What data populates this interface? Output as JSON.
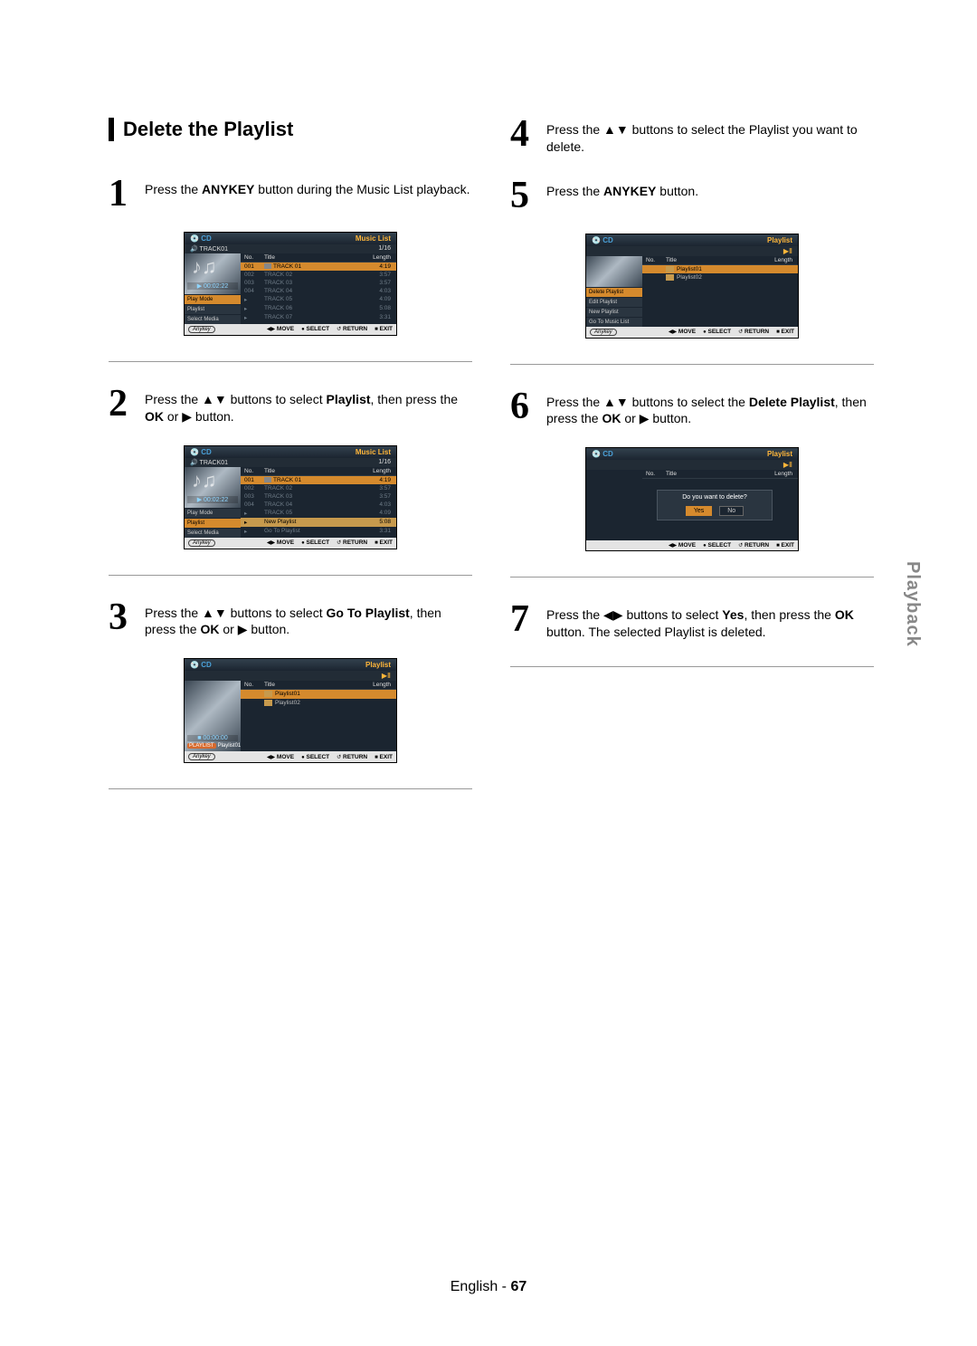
{
  "title": "Delete the Playlist",
  "side_tab": "Playback",
  "footer": {
    "lang": "English",
    "sep": " - ",
    "page": "67"
  },
  "step1": {
    "num": "1",
    "t1": "Press the ",
    "b1": "ANYKEY",
    "t2": " button during the Music List playback."
  },
  "step2": {
    "num": "2",
    "t1": "Press the ▲▼ buttons to select ",
    "b1": "Playlist",
    "t2": ", then press the ",
    "b2": "OK",
    "t3": " or ▶ button."
  },
  "step3": {
    "num": "3",
    "t1": "Press the ▲▼ buttons to select ",
    "b1": "Go To Playlist",
    "t2": ", then press the ",
    "b2": "OK",
    "t3": " or ▶ button."
  },
  "step4": {
    "num": "4",
    "t1": "Press the ▲▼ buttons to select the Playlist you want to delete."
  },
  "step5": {
    "num": "5",
    "t1": "Press the ",
    "b1": "ANYKEY",
    "t2": " button."
  },
  "step6": {
    "num": "6",
    "t1": "Press the ▲▼ buttons to select the ",
    "b1": "Delete Playlist",
    "t2": ", then press the  ",
    "b2": "OK",
    "t3": " or ▶ button."
  },
  "step7": {
    "num": "7",
    "t1": "Press the ◀▶ buttons to select ",
    "b1": "Yes",
    "t2": ", then press the ",
    "b2": "OK",
    "t3": " button. The selected Playlist is deleted."
  },
  "osd_common": {
    "nav": {
      "anykey": "Anykey",
      "move": "MOVE",
      "select": "SELECT",
      "return": "RETURN",
      "exit": "EXIT",
      "move_icon": "◀▶",
      "select_icon": "●",
      "return_icon": "↺",
      "exit_icon": "■"
    },
    "cols": {
      "no": "No.",
      "title": "Title",
      "length": "Length"
    }
  },
  "osd1": {
    "cd": "CD",
    "label": "Music List",
    "track": "TRACK01",
    "counter": "1/16",
    "time": "00:02:22",
    "menu": [
      "Play Mode",
      "Playlist",
      "Select Media"
    ],
    "tracks": [
      {
        "no": "001",
        "title": "TRACK 01",
        "len": "4:19"
      },
      {
        "no": "002",
        "title": "TRACK 02",
        "len": "3:57"
      },
      {
        "no": "003",
        "title": "TRACK 03",
        "len": "3:57"
      },
      {
        "no": "004",
        "title": "TRACK 04",
        "len": "4:03"
      },
      {
        "no": "",
        "title": "TRACK 05",
        "len": "4:09"
      },
      {
        "no": "",
        "title": "TRACK 06",
        "len": "5:08"
      },
      {
        "no": "",
        "title": "TRACK 07",
        "len": "3:31"
      }
    ]
  },
  "osd2": {
    "cd": "CD",
    "label": "Music List",
    "track": "TRACK01",
    "counter": "1/16",
    "time": "00:02:22",
    "menu": [
      "Play Mode",
      "Playlist",
      "Select Media"
    ],
    "submenu": [
      "New Playlist",
      "Go To Playlist"
    ],
    "tracks": [
      {
        "no": "001",
        "title": "TRACK 01",
        "len": "4:19"
      },
      {
        "no": "002",
        "title": "TRACK 02",
        "len": "3:57"
      },
      {
        "no": "003",
        "title": "TRACK 03",
        "len": "3:57"
      },
      {
        "no": "004",
        "title": "TRACK 04",
        "len": "4:03"
      },
      {
        "no": "",
        "title": "TRACK 05",
        "len": "4:09"
      },
      {
        "no": "",
        "title": "New Playlist",
        "len": "5:08"
      },
      {
        "no": "",
        "title": "Go To Playlist",
        "len": "3:31"
      }
    ]
  },
  "osd3": {
    "cd": "CD",
    "label": "Playlist",
    "time": "00:00:00",
    "pill": "PLAYLIST",
    "pname": "Playlist01",
    "items": [
      "Playlist01",
      "Playlist02"
    ]
  },
  "osd5": {
    "cd": "CD",
    "label": "Playlist",
    "menu": [
      "Delete Playlist",
      "Edit Playlist",
      "New Playlist",
      "Go To Music List"
    ],
    "items": [
      "Playlist01",
      "Playlist02"
    ]
  },
  "osd6": {
    "cd": "CD",
    "label": "Playlist",
    "question": "Do you want to delete?",
    "yes": "Yes",
    "no": "No"
  }
}
